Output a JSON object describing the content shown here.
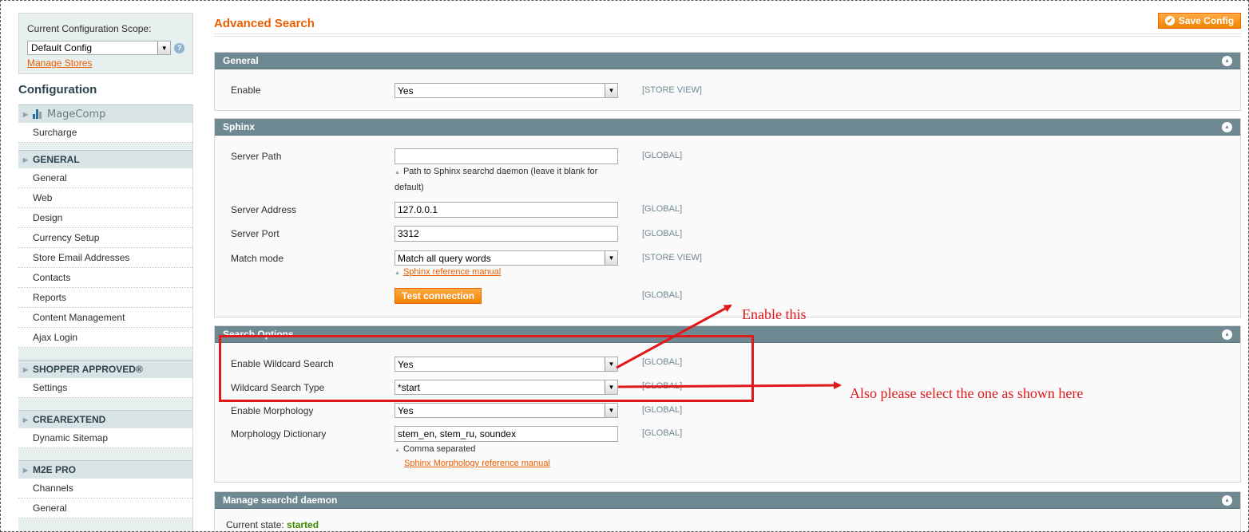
{
  "scope": {
    "label": "Current Configuration Scope:",
    "selected": "Default Config",
    "manage_stores": "Manage Stores"
  },
  "sidebar": {
    "title": "Configuration",
    "groups": [
      {
        "heading": "MageComp",
        "items": [
          "Surcharge"
        ]
      },
      {
        "heading": "GENERAL",
        "items": [
          "General",
          "Web",
          "Design",
          "Currency Setup",
          "Store Email Addresses",
          "Contacts",
          "Reports",
          "Content Management",
          "Ajax Login"
        ]
      },
      {
        "heading": "SHOPPER APPROVED®",
        "items": [
          "Settings"
        ]
      },
      {
        "heading": "CREAREXTEND",
        "items": [
          "Dynamic Sitemap"
        ]
      },
      {
        "heading": "M2E PRO",
        "items": [
          "Channels",
          "General"
        ]
      }
    ]
  },
  "page": {
    "title": "Advanced Search",
    "save_label": "Save Config"
  },
  "sections": {
    "general": {
      "title": "General",
      "enable_label": "Enable",
      "enable_value": "Yes",
      "enable_scope": "[STORE VIEW]"
    },
    "sphinx": {
      "title": "Sphinx",
      "server_path_label": "Server Path",
      "server_path_value": "",
      "server_path_scope": "[GLOBAL]",
      "server_path_note": "Path to Sphinx searchd daemon (leave it blank for default)",
      "server_address_label": "Server Address",
      "server_address_value": "127.0.0.1",
      "server_address_scope": "[GLOBAL]",
      "server_port_label": "Server Port",
      "server_port_value": "3312",
      "server_port_scope": "[GLOBAL]",
      "match_mode_label": "Match mode",
      "match_mode_value": "Match all query words",
      "match_mode_scope": "[STORE VIEW]",
      "match_mode_link": "Sphinx reference manual",
      "test_button": "Test connection",
      "test_scope": "[GLOBAL]"
    },
    "search_options": {
      "title": "Search Options",
      "wildcard_label": "Enable Wildcard Search",
      "wildcard_value": "Yes",
      "wildcard_scope": "[GLOBAL]",
      "wildcard_type_label": "Wildcard Search Type",
      "wildcard_type_value": "*start",
      "wildcard_type_scope": "[GLOBAL]",
      "morphology_label": "Enable Morphology",
      "morphology_value": "Yes",
      "morphology_scope": "[GLOBAL]",
      "dictionary_label": "Morphology Dictionary",
      "dictionary_value": "stem_en, stem_ru, soundex",
      "dictionary_scope": "[GLOBAL]",
      "dictionary_note": "Comma separated",
      "dictionary_link": "Sphinx Morphology reference manual"
    },
    "daemon": {
      "title": "Manage searchd daemon",
      "state_label": "Current state:",
      "state_value": "started"
    }
  },
  "annotations": {
    "enable_this": "Enable this",
    "select_shown": "Also please select the one as shown here",
    "color": "#e0191c"
  }
}
